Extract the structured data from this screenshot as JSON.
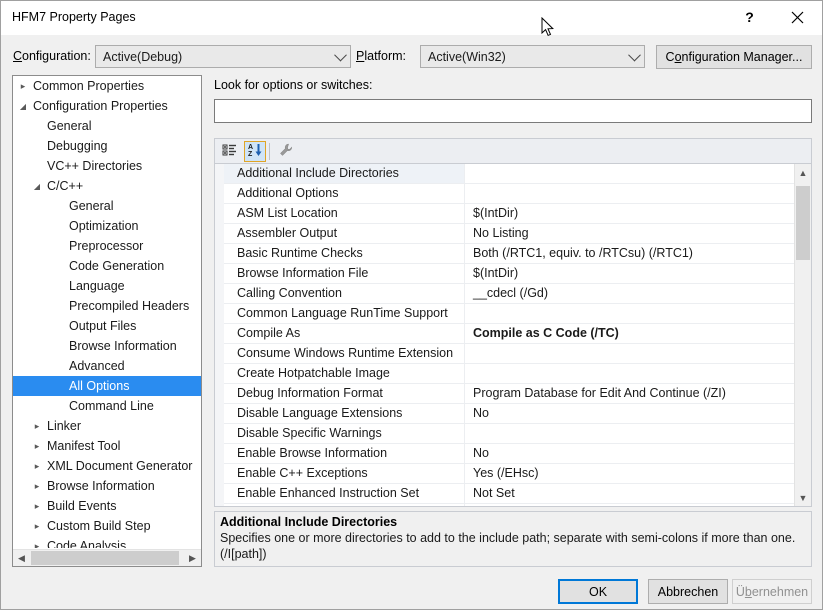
{
  "window": {
    "title": "HFM7 Property Pages",
    "help_icon": "question-mark-icon",
    "close_icon": "close-icon"
  },
  "config_bar": {
    "configuration_label": "Configuration:",
    "configuration_value": "Active(Debug)",
    "platform_label": "Platform:",
    "platform_value": "Active(Win32)",
    "configuration_manager_label": "Configuration Manager..."
  },
  "tree": {
    "selected": "All Options",
    "items": [
      {
        "label": "Common Properties",
        "level": 0,
        "expander": "collapsed"
      },
      {
        "label": "Configuration Properties",
        "level": 0,
        "expander": "expanded"
      },
      {
        "label": "General",
        "level": 1,
        "expander": "none"
      },
      {
        "label": "Debugging",
        "level": 1,
        "expander": "none"
      },
      {
        "label": "VC++ Directories",
        "level": 1,
        "expander": "none"
      },
      {
        "label": "C/C++",
        "level": 1,
        "expander": "expanded"
      },
      {
        "label": "General",
        "level": 2,
        "expander": "none"
      },
      {
        "label": "Optimization",
        "level": 2,
        "expander": "none"
      },
      {
        "label": "Preprocessor",
        "level": 2,
        "expander": "none"
      },
      {
        "label": "Code Generation",
        "level": 2,
        "expander": "none"
      },
      {
        "label": "Language",
        "level": 2,
        "expander": "none"
      },
      {
        "label": "Precompiled Headers",
        "level": 2,
        "expander": "none"
      },
      {
        "label": "Output Files",
        "level": 2,
        "expander": "none"
      },
      {
        "label": "Browse Information",
        "level": 2,
        "expander": "none"
      },
      {
        "label": "Advanced",
        "level": 2,
        "expander": "none"
      },
      {
        "label": "All Options",
        "level": 2,
        "expander": "none",
        "selected": true
      },
      {
        "label": "Command Line",
        "level": 2,
        "expander": "none"
      },
      {
        "label": "Linker",
        "level": 1,
        "expander": "collapsed"
      },
      {
        "label": "Manifest Tool",
        "level": 1,
        "expander": "collapsed"
      },
      {
        "label": "XML Document Generator",
        "level": 1,
        "expander": "collapsed"
      },
      {
        "label": "Browse Information",
        "level": 1,
        "expander": "collapsed"
      },
      {
        "label": "Build Events",
        "level": 1,
        "expander": "collapsed"
      },
      {
        "label": "Custom Build Step",
        "level": 1,
        "expander": "collapsed"
      },
      {
        "label": "Code Analysis",
        "level": 1,
        "expander": "collapsed"
      }
    ]
  },
  "search": {
    "label": "Look for options or switches:",
    "value": "",
    "placeholder": ""
  },
  "toolbar": {
    "categorized_icon": "categorized-view-icon",
    "alphabetical_icon": "sort-alphabetical-icon",
    "properties_icon": "wrench-icon",
    "active": "alphabetical"
  },
  "grid": {
    "selected_row": "Additional Include Directories",
    "rows": [
      {
        "name": "Additional Include Directories",
        "value": "",
        "modified": false,
        "selected": true
      },
      {
        "name": "Additional Options",
        "value": "",
        "modified": false
      },
      {
        "name": "ASM List Location",
        "value": "$(IntDir)",
        "modified": false
      },
      {
        "name": "Assembler Output",
        "value": "No Listing",
        "modified": false
      },
      {
        "name": "Basic Runtime Checks",
        "value": "Both (/RTC1, equiv. to /RTCsu) (/RTC1)",
        "modified": false
      },
      {
        "name": "Browse Information File",
        "value": "$(IntDir)",
        "modified": false
      },
      {
        "name": "Calling Convention",
        "value": "__cdecl (/Gd)",
        "modified": false
      },
      {
        "name": "Common Language RunTime Support",
        "value": "",
        "modified": false
      },
      {
        "name": "Compile As",
        "value": "Compile as C Code (/TC)",
        "modified": true
      },
      {
        "name": "Consume Windows Runtime Extension",
        "value": "",
        "modified": false
      },
      {
        "name": "Create Hotpatchable Image",
        "value": "",
        "modified": false
      },
      {
        "name": "Debug Information Format",
        "value": "Program Database for Edit And Continue (/ZI)",
        "modified": false
      },
      {
        "name": "Disable Language Extensions",
        "value": "No",
        "modified": false
      },
      {
        "name": "Disable Specific Warnings",
        "value": "",
        "modified": false
      },
      {
        "name": "Enable Browse Information",
        "value": "No",
        "modified": false
      },
      {
        "name": "Enable C++ Exceptions",
        "value": "Yes (/EHsc)",
        "modified": false
      },
      {
        "name": "Enable Enhanced Instruction Set",
        "value": "Not Set",
        "modified": false
      },
      {
        "name": "Enable Fiber-Safe Optimizations",
        "value": "No",
        "modified": false
      }
    ]
  },
  "description": {
    "title": "Additional Include Directories",
    "body": "Specifies one or more directories to add to the include path; separate with semi-colons if more than one. (/I[path])"
  },
  "buttons": {
    "ok": "OK",
    "cancel": "Abbrechen",
    "apply": "Übernehmen"
  },
  "colors": {
    "dialog_background": "#f0f0f0",
    "selection_blue": "#2a8cf0",
    "accent_focus": "#0078d7",
    "toolbar_active_border": "#e0a526"
  }
}
